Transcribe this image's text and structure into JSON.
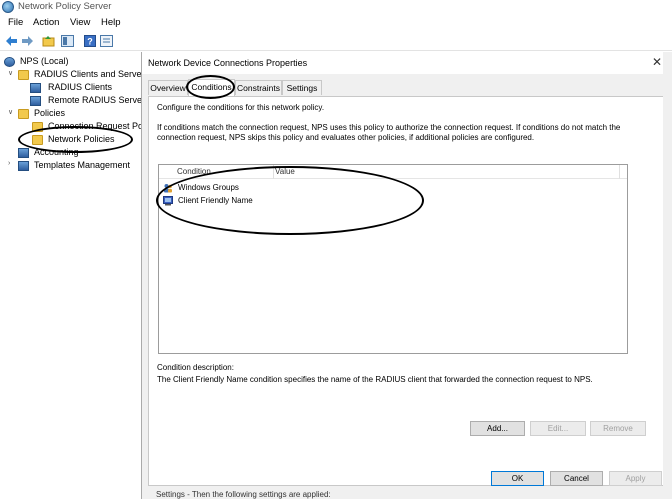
{
  "window": {
    "title": "Network Policy Server"
  },
  "menu": [
    "File",
    "Action",
    "View",
    "Help"
  ],
  "toolbar": {
    "icons": [
      "back-arrow-icon",
      "forward-arrow-icon",
      "up-folder-icon",
      "show-hide-tree-icon",
      "help-icon",
      "properties-icon"
    ]
  },
  "tree": {
    "items": [
      {
        "label": "NPS (Local)"
      },
      {
        "label": "RADIUS Clients and Servers"
      },
      {
        "label": "RADIUS Clients"
      },
      {
        "label": "Remote RADIUS Server"
      },
      {
        "label": "Policies"
      },
      {
        "label": "Connection Request Po"
      },
      {
        "label": "Network Policies"
      },
      {
        "label": "Accounting"
      },
      {
        "label": "Templates Management"
      }
    ]
  },
  "dialog": {
    "title": "Network Device Connections Properties",
    "close": "✕",
    "tabs": [
      {
        "label": "Overview"
      },
      {
        "label": "Conditions"
      },
      {
        "label": "Constraints"
      },
      {
        "label": "Settings"
      }
    ],
    "intro": "Configure the conditions for this network policy.",
    "explain_line1": "If conditions match the connection request, NPS uses this policy to authorize the connection request. If conditions do not match the",
    "explain_line2": "connection request, NPS skips this policy and evaluates other policies, if additional policies are configured.",
    "list": {
      "col_condition": "Condition",
      "col_value": "Value",
      "rows": [
        {
          "label": "Windows Groups",
          "value": ""
        },
        {
          "label": "Client Friendly Name",
          "value": ""
        }
      ]
    },
    "desc_label": "Condition description:",
    "desc_text": "The Client Friendly Name condition specifies the name of the RADIUS client that forwarded the connection request to NPS.",
    "buttons": {
      "add": "Add...",
      "edit": "Edit...",
      "remove": "Remove",
      "ok": "OK",
      "cancel": "Cancel",
      "apply": "Apply"
    },
    "peek_text": "Settings - Then the following settings are applied:"
  }
}
